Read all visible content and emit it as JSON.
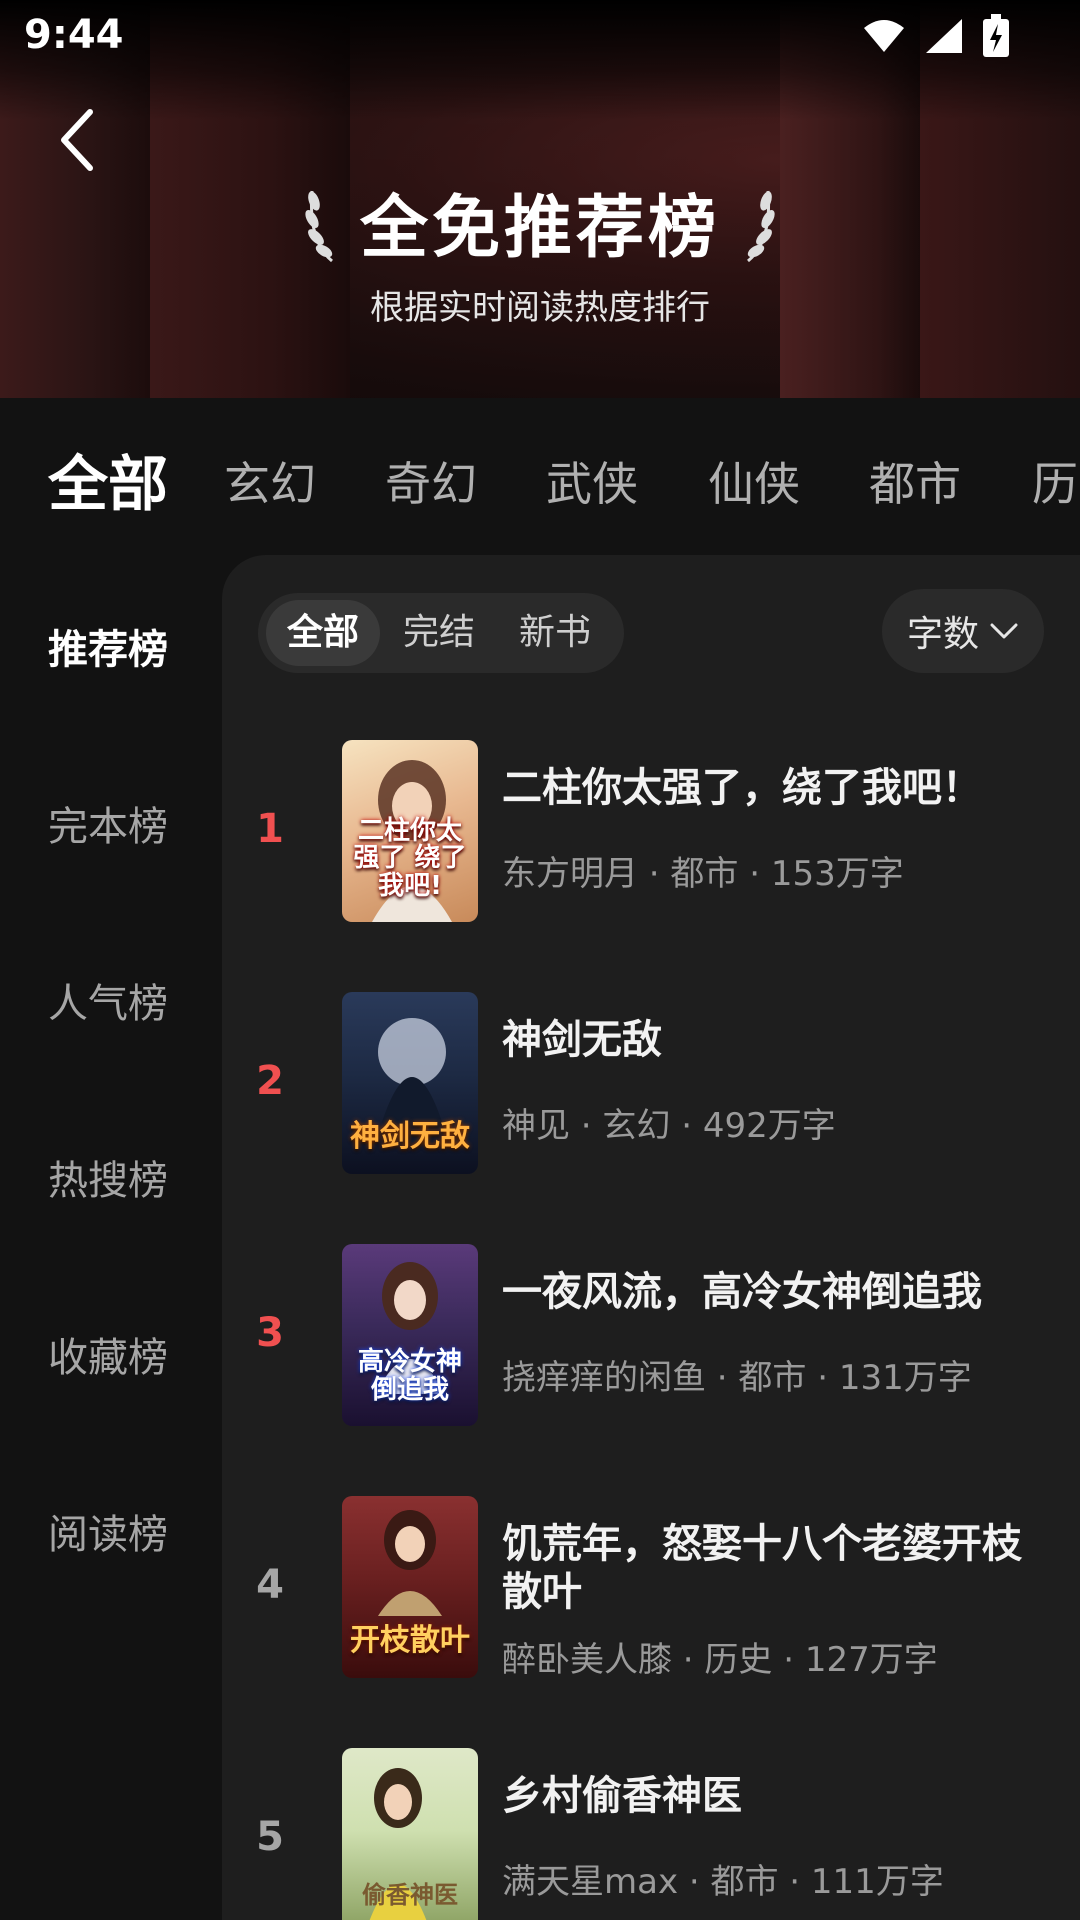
{
  "status_bar": {
    "time": "9:44"
  },
  "header": {
    "title": "全免推荐榜",
    "subtitle": "根据实时阅读热度排行"
  },
  "categories": [
    {
      "label": "全部",
      "active": true
    },
    {
      "label": "玄幻",
      "active": false
    },
    {
      "label": "奇幻",
      "active": false
    },
    {
      "label": "武侠",
      "active": false
    },
    {
      "label": "仙侠",
      "active": false
    },
    {
      "label": "都市",
      "active": false
    },
    {
      "label": "历",
      "active": false
    }
  ],
  "sidebar": {
    "items": [
      {
        "label": "推荐榜",
        "active": true
      },
      {
        "label": "完本榜",
        "active": false
      },
      {
        "label": "人气榜",
        "active": false
      },
      {
        "label": "热搜榜",
        "active": false
      },
      {
        "label": "收藏榜",
        "active": false
      },
      {
        "label": "阅读榜",
        "active": false
      }
    ]
  },
  "filters": {
    "chips": [
      {
        "label": "全部",
        "active": true
      },
      {
        "label": "完结",
        "active": false
      },
      {
        "label": "新书",
        "active": false
      }
    ],
    "sort_label": "字数"
  },
  "books": [
    {
      "rank": "1",
      "title": "二柱你太强了，绕了我吧！",
      "meta": "东方明月 · 都市 · 153万字",
      "cover_text": "二柱你太强了 绕了我吧!",
      "cover_colors": [
        "#f6e3c0",
        "#c88a5a"
      ]
    },
    {
      "rank": "2",
      "title": "神剑无敌",
      "meta": "神见 · 玄幻 · 492万字",
      "cover_text": "神剑无敌",
      "cover_colors": [
        "#1d2a44",
        "#0c1020"
      ]
    },
    {
      "rank": "3",
      "title": "一夜风流，高冷女神倒追我",
      "meta": "挠痒痒的闲鱼 · 都市 · 131万字",
      "cover_text": "高冷女神 倒追我",
      "cover_colors": [
        "#3a2a5a",
        "#1a1030"
      ]
    },
    {
      "rank": "4",
      "title": "饥荒年，怒娶十八个老婆开枝散叶",
      "meta": "醉卧美人膝 · 历史 · 127万字",
      "cover_text": "开枝散叶",
      "cover_colors": [
        "#6a2020",
        "#3a0c0c"
      ]
    },
    {
      "rank": "5",
      "title": "乡村偷香神医",
      "meta": "满天星max · 都市 · 111万字",
      "cover_text": "偷香神医",
      "cover_colors": [
        "#cfe0b0",
        "#8aa060"
      ]
    }
  ],
  "colors": {
    "rank_hot": "#f05050",
    "rank_normal": "#a6a6a6"
  }
}
